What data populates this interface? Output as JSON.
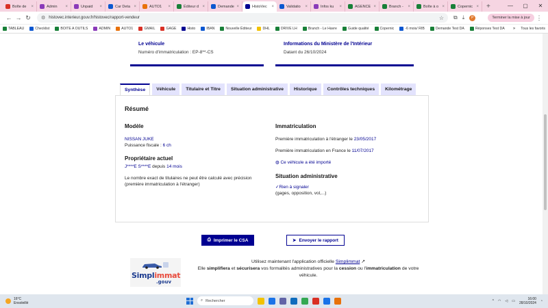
{
  "browser": {
    "tabs": [
      {
        "label": "Boîte de",
        "color": "#d93025"
      },
      {
        "label": "Admin",
        "color": "#8a3ab9"
      },
      {
        "label": "Unpaid",
        "color": "#8a3ab9"
      },
      {
        "label": "Car Deta",
        "color": "#0b57d0"
      },
      {
        "label": "AUTO1",
        "color": "#e8710a"
      },
      {
        "label": "Éditeur d",
        "color": "#188038"
      },
      {
        "label": "Demande",
        "color": "#0b57d0"
      },
      {
        "label": "HistoVec",
        "color": "#000091",
        "active": true
      },
      {
        "label": "Validatio",
        "color": "#0b57d0"
      },
      {
        "label": "Infos ku",
        "color": "#8a3ab9"
      },
      {
        "label": "AGENCE",
        "color": "#188038"
      },
      {
        "label": "Branch -",
        "color": "#188038"
      },
      {
        "label": "Boîte à o",
        "color": "#188038"
      },
      {
        "label": "Copernic",
        "color": "#188038"
      }
    ],
    "url": "histovec.interieur.gouv.fr/histovec/rapport-vendeur",
    "update_label": "Terminer la mise à jour",
    "profile_initial": "P",
    "bookmarks": [
      {
        "label": "TABLEAU",
        "color": "#188038"
      },
      {
        "label": "Checklist",
        "color": "#0b57d0"
      },
      {
        "label": "BOITE A OUTILS",
        "color": "#188038"
      },
      {
        "label": "ADMIN",
        "color": "#8a3ab9"
      },
      {
        "label": "AUTO1",
        "color": "#e8710a"
      },
      {
        "label": "GMAIL",
        "color": "#d93025"
      },
      {
        "label": "GAGE",
        "color": "#d93025"
      },
      {
        "label": "Histo",
        "color": "#000091"
      },
      {
        "label": "IBAN",
        "color": "#0b57d0"
      },
      {
        "label": "Nouvelle Éditeur",
        "color": "#188038"
      },
      {
        "label": "DHL",
        "color": "#f2c200"
      },
      {
        "label": "DRIVE LH",
        "color": "#188038"
      },
      {
        "label": "Branch - Le Havre",
        "color": "#188038"
      },
      {
        "label": "Guide qualité",
        "color": "#188038"
      },
      {
        "label": "Copernic",
        "color": "#188038"
      },
      {
        "label": "-6 mois/ RIB",
        "color": "#0b57d0"
      },
      {
        "label": "Demande Test DA",
        "color": "#188038"
      },
      {
        "label": "Réponses Test DA",
        "color": "#188038"
      }
    ],
    "bookmarks_more": "»",
    "all_bookmarks": "Tous les favoris"
  },
  "cards": {
    "vehicle": {
      "title": "Le véhicule",
      "subtitle": "Numéro d'immatriculation : EP-8**-CS"
    },
    "ministry": {
      "title": "Informations du Ministère de l'Intérieur",
      "subtitle": "Datant du 26/10/2024"
    }
  },
  "report_tabs": [
    "Synthèse",
    "Véhicule",
    "Titulaire et Titre",
    "Situation administrative",
    "Historique",
    "Contrôles techniques",
    "Kilométrage"
  ],
  "summary": {
    "heading": "Résumé",
    "model": {
      "heading": "Modèle",
      "name": "NISSAN JUKE",
      "power_label": "Puissance fiscale : ",
      "power_value": "6 ch"
    },
    "owner": {
      "heading": "Propriétaire actuel",
      "name": "J****E S****E",
      "since_label": " depuis ",
      "since_value": "14 mois",
      "note": "Le nombre exact de titulaires ne peut être calculé avec précision (première immatriculation à l'étranger)"
    },
    "registration": {
      "heading": "Immatriculation",
      "first_abroad_label": "Première immatriculation à l'étranger le ",
      "first_abroad_date": "23/05/2017",
      "first_france_label": "Première immatriculation en France le ",
      "first_france_date": "11/07/2017",
      "imported": "Ce véhicule a été importé"
    },
    "admin": {
      "heading": "Situation administrative",
      "status": "Rien à signaler",
      "detail": "(gages, opposition, vol,...)"
    }
  },
  "actions": {
    "print": "Imprimer le CSA",
    "send": "Envoyer le rapport"
  },
  "promo": {
    "logo_main": "Simpl",
    "logo_accent": "immat",
    "logo_gouv": ".gouv",
    "line1_prefix": "Utilisez maintenant l'application officielle ",
    "line1_link": "Simplimmat",
    "line2_a": "Elle ",
    "line2_b": "simplifiera",
    "line2_c": " et ",
    "line2_d": "sécurisera",
    "line2_e": " vos formalités administratives pour la ",
    "line2_f": "cession",
    "line2_g": " ou l'",
    "line2_h": "immatriculation",
    "line2_i": " de votre véhicule."
  },
  "taskbar": {
    "temp": "16°C",
    "weather": "Ensoleillé",
    "search": "Rechercher",
    "time": "16:00",
    "date": "28/10/2024",
    "apps": [
      "#f2c200",
      "#1a73e8",
      "#6264a7",
      "#0f6cbd",
      "#34a853",
      "#d93025",
      "#1a73e8",
      "#e8710a"
    ]
  }
}
